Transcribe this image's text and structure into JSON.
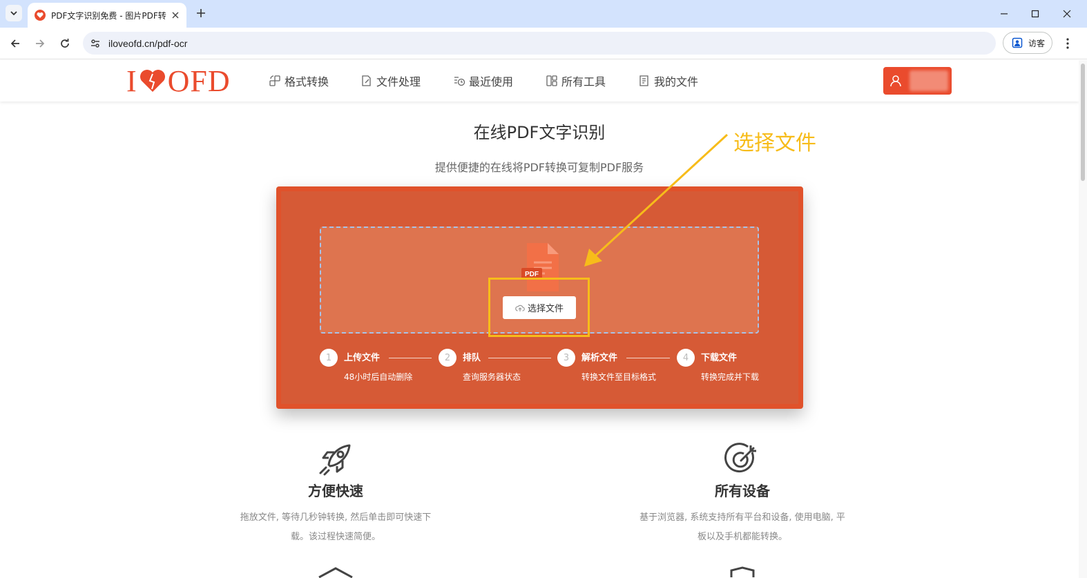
{
  "browser": {
    "tab_title": "PDF文字识别免费 - 图片PDF转",
    "url": "iloveofd.cn/pdf-ocr",
    "guest_label": "访客"
  },
  "site": {
    "logo_text_left": "I",
    "logo_text_right": "OFD",
    "nav": [
      {
        "label": "格式转换",
        "icon": "convert-icon"
      },
      {
        "label": "文件处理",
        "icon": "edit-file-icon"
      },
      {
        "label": "最近使用",
        "icon": "recent-icon"
      },
      {
        "label": "所有工具",
        "icon": "grid-icon"
      },
      {
        "label": "我的文件",
        "icon": "my-files-icon"
      }
    ]
  },
  "hero": {
    "title": "在线PDF文字识别",
    "subtitle": "提供便捷的在线将PDF转换可复制PDF服务",
    "file_badge": "PDF",
    "choose_button": "选择文件"
  },
  "steps": [
    {
      "num": "1",
      "title": "上传文件",
      "desc": "48小时后自动删除"
    },
    {
      "num": "2",
      "title": "排队",
      "desc": "查询服务器状态"
    },
    {
      "num": "3",
      "title": "解析文件",
      "desc": "转换文件至目标格式"
    },
    {
      "num": "4",
      "title": "下载文件",
      "desc": "转换完成并下载"
    }
  ],
  "annotation": {
    "label": "选择文件",
    "color": "#f7bc1a"
  },
  "features": [
    {
      "title": "方便快速",
      "desc_line1": "拖放文件, 等待几秒钟转换, 然后单击即可快速下",
      "desc_line2": "载。该过程快速简便。",
      "icon": "rocket-icon"
    },
    {
      "title": "所有设备",
      "desc_line1": "基于浏览器, 系统支持所有平台和设备, 使用电脑, 平",
      "desc_line2": "板以及手机都能转换。",
      "icon": "target-icon"
    }
  ],
  "colors": {
    "brand": "#ea4b2d",
    "panel": "#d65a36",
    "dropzone": "#de744f"
  }
}
